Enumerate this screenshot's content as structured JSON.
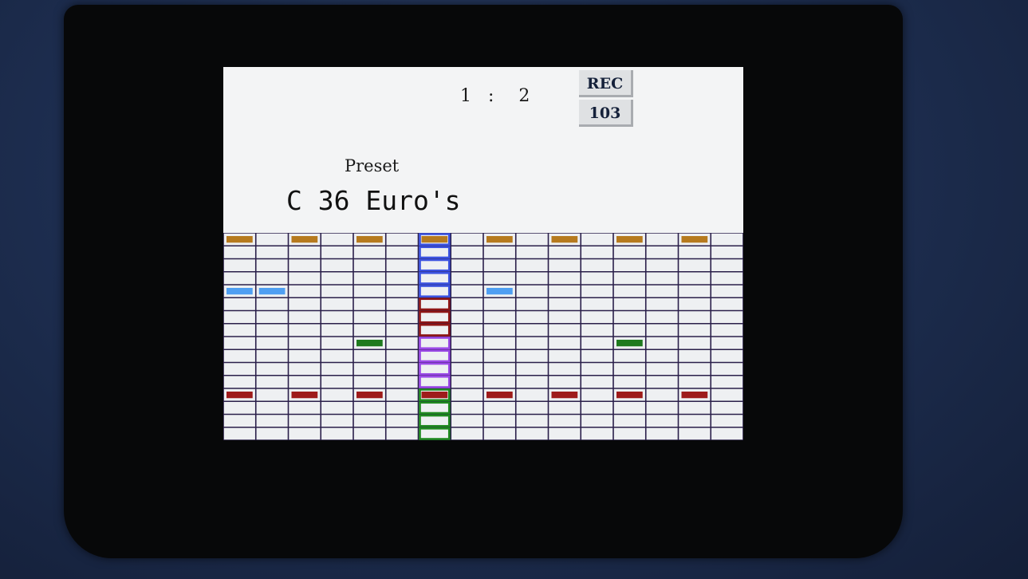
{
  "header": {
    "counter": {
      "left": "1",
      "separator": ":",
      "right": "2"
    },
    "rec_label": "REC",
    "value": "103"
  },
  "preset": {
    "label": "Preset",
    "name": "C 36 Euro's"
  },
  "colors": {
    "grid_line": "#2a1f4a",
    "orange": "#b67a1e",
    "blue": "#4f9ff2",
    "green": "#1f7a1f",
    "red": "#9e1b1b",
    "playhead_blue": "#3b52e0",
    "playhead_red": "#8e1515",
    "playhead_purple": "#9a48e6",
    "playhead_green": "#1f8a1f"
  },
  "sequencer": {
    "columns": 16,
    "rows": 16,
    "playhead_column": 6,
    "playhead_segments": [
      {
        "from_row": 0,
        "to_row": 4,
        "color": "playhead_blue"
      },
      {
        "from_row": 5,
        "to_row": 7,
        "color": "playhead_red"
      },
      {
        "from_row": 8,
        "to_row": 11,
        "color": "playhead_purple"
      },
      {
        "from_row": 12,
        "to_row": 15,
        "color": "playhead_green"
      }
    ],
    "notes": [
      {
        "row": 0,
        "col": 0,
        "color": "orange"
      },
      {
        "row": 0,
        "col": 2,
        "color": "orange"
      },
      {
        "row": 0,
        "col": 4,
        "color": "orange"
      },
      {
        "row": 0,
        "col": 6,
        "color": "orange"
      },
      {
        "row": 0,
        "col": 8,
        "color": "orange"
      },
      {
        "row": 0,
        "col": 10,
        "color": "orange"
      },
      {
        "row": 0,
        "col": 12,
        "color": "orange"
      },
      {
        "row": 0,
        "col": 14,
        "color": "orange"
      },
      {
        "row": 4,
        "col": 0,
        "color": "blue"
      },
      {
        "row": 4,
        "col": 1,
        "color": "blue"
      },
      {
        "row": 4,
        "col": 8,
        "color": "blue"
      },
      {
        "row": 8,
        "col": 4,
        "color": "green"
      },
      {
        "row": 8,
        "col": 12,
        "color": "green"
      },
      {
        "row": 12,
        "col": 0,
        "color": "red"
      },
      {
        "row": 12,
        "col": 2,
        "color": "red"
      },
      {
        "row": 12,
        "col": 4,
        "color": "red"
      },
      {
        "row": 12,
        "col": 6,
        "color": "red"
      },
      {
        "row": 12,
        "col": 8,
        "color": "red"
      },
      {
        "row": 12,
        "col": 10,
        "color": "red"
      },
      {
        "row": 12,
        "col": 12,
        "color": "red"
      },
      {
        "row": 12,
        "col": 14,
        "color": "red"
      }
    ]
  }
}
